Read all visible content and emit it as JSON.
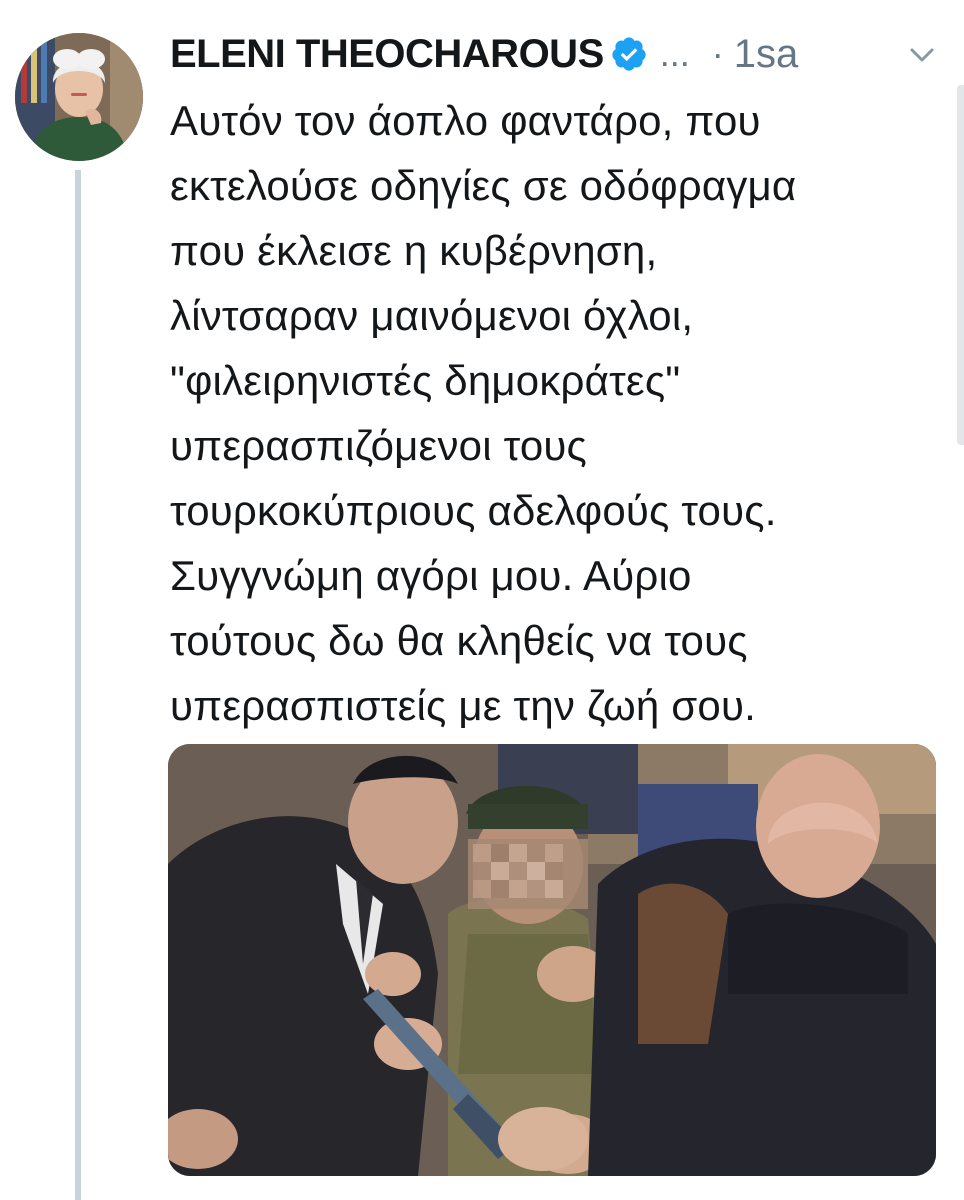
{
  "tweet": {
    "author_name": "ELENI THEOCHAROUS",
    "verified_icon": "verified-badge-icon",
    "more_label": "...",
    "separator": "·",
    "timestamp": "1sa",
    "menu_icon": "chevron-down-icon",
    "text_lines": [
      "Αυτόν τον άοπλο φαντάρο, που",
      "εκτελούσε οδηγίες σε οδόφραγμα",
      "που έκλεισε η κυβέρνηση,",
      "λίντσαραν μαινόμενοι όχλοι,",
      "\"φιλειρηνιστές δημοκράτες\"",
      "υπερασπιζόμενοι τους",
      "τουρκοκύπριους αδελφούς τους.",
      "Συγγνώμη αγόρι μου. Αύριο",
      "τούτους δω θα κληθείς να τους",
      "υπερασπιστείς με την ζωή σου."
    ]
  },
  "colors": {
    "text": "#14171a",
    "muted": "#657786",
    "verified": "#1da1f2",
    "thread_line": "#c9d3dc"
  }
}
